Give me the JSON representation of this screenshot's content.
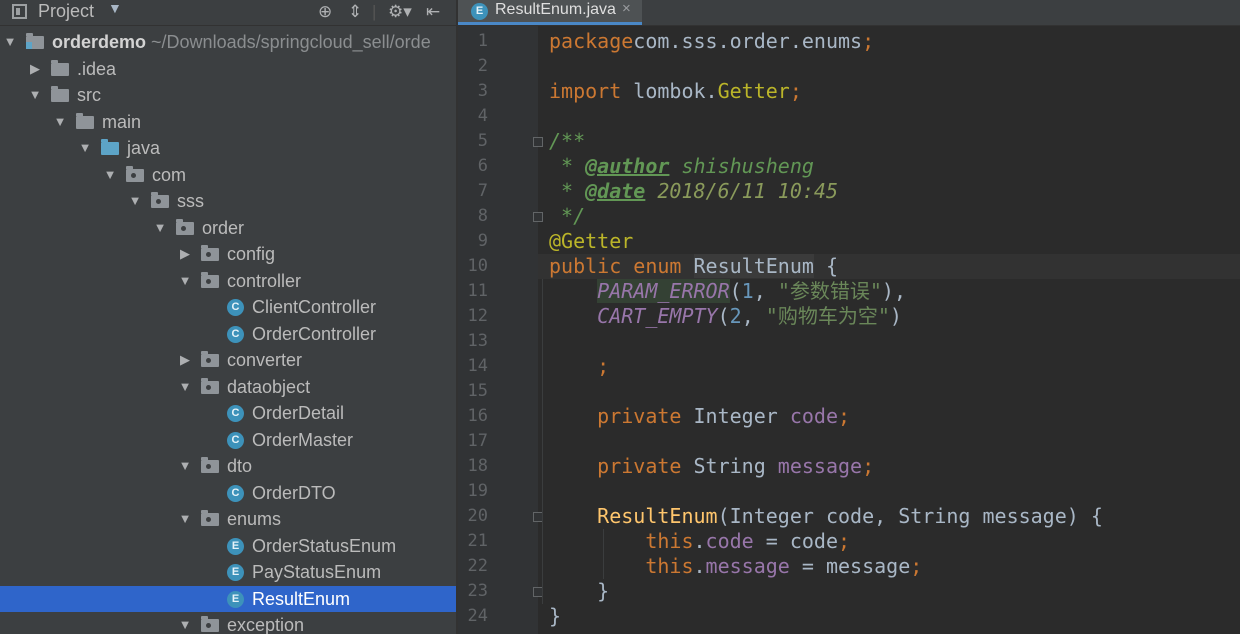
{
  "project_panel": {
    "title": "Project",
    "tree": [
      {
        "label": "orderdemo",
        "hint": "~/Downloads/springcloud_sell/orde",
        "kind": "module",
        "depth": 0,
        "state": "open"
      },
      {
        "label": ".idea",
        "kind": "folder",
        "depth": 1,
        "state": "closed"
      },
      {
        "label": "src",
        "kind": "folder",
        "depth": 1,
        "state": "open"
      },
      {
        "label": "main",
        "kind": "folder",
        "depth": 2,
        "state": "open"
      },
      {
        "label": "java",
        "kind": "source-folder",
        "depth": 3,
        "state": "open"
      },
      {
        "label": "com",
        "kind": "package",
        "depth": 4,
        "state": "open"
      },
      {
        "label": "sss",
        "kind": "package",
        "depth": 5,
        "state": "open"
      },
      {
        "label": "order",
        "kind": "package",
        "depth": 6,
        "state": "open"
      },
      {
        "label": "config",
        "kind": "package",
        "depth": 7,
        "state": "closed"
      },
      {
        "label": "controller",
        "kind": "package",
        "depth": 7,
        "state": "open"
      },
      {
        "label": "ClientController",
        "kind": "class",
        "badge": "C",
        "depth": 8
      },
      {
        "label": "OrderController",
        "kind": "class",
        "badge": "C",
        "depth": 8
      },
      {
        "label": "converter",
        "kind": "package",
        "depth": 7,
        "state": "closed"
      },
      {
        "label": "dataobject",
        "kind": "package",
        "depth": 7,
        "state": "open"
      },
      {
        "label": "OrderDetail",
        "kind": "class",
        "badge": "C",
        "depth": 8
      },
      {
        "label": "OrderMaster",
        "kind": "class",
        "badge": "C",
        "depth": 8
      },
      {
        "label": "dto",
        "kind": "package",
        "depth": 7,
        "state": "open"
      },
      {
        "label": "OrderDTO",
        "kind": "class",
        "badge": "C",
        "depth": 8
      },
      {
        "label": "enums",
        "kind": "package",
        "depth": 7,
        "state": "open"
      },
      {
        "label": "OrderStatusEnum",
        "kind": "enum",
        "badge": "E",
        "depth": 8
      },
      {
        "label": "PayStatusEnum",
        "kind": "enum",
        "badge": "E",
        "depth": 8
      },
      {
        "label": "ResultEnum",
        "kind": "enum",
        "badge": "E",
        "depth": 8,
        "selected": true
      },
      {
        "label": "exception",
        "kind": "package",
        "depth": 7,
        "state": "open"
      }
    ]
  },
  "editor": {
    "tab": {
      "label": "ResultEnum.java",
      "badge": "E",
      "close": "×"
    },
    "current_line": 10,
    "lines": [
      {
        "n": "1",
        "tokens": [
          [
            "kw",
            "package"
          ],
          [
            "",
            "com.sss.order.enums"
          ],
          [
            "kw",
            ";"
          ]
        ]
      },
      {
        "n": "2",
        "tokens": []
      },
      {
        "n": "3",
        "tokens": [
          [
            "kw",
            "import"
          ],
          [
            "",
            " lombok."
          ],
          [
            "ann",
            "Getter"
          ],
          [
            "kw",
            ";"
          ]
        ]
      },
      {
        "n": "4",
        "tokens": []
      },
      {
        "n": "5",
        "tokens": [
          [
            "doc",
            "/**"
          ]
        ]
      },
      {
        "n": "6",
        "tokens": [
          [
            "doc",
            " * "
          ],
          [
            "doctag",
            "@author"
          ],
          [
            "doc",
            " shishusheng"
          ]
        ]
      },
      {
        "n": "7",
        "tokens": [
          [
            "doc",
            " * "
          ],
          [
            "doctag",
            "@date"
          ],
          [
            "docval",
            " 2018/6/11 10:45"
          ]
        ]
      },
      {
        "n": "8",
        "tokens": [
          [
            "doc",
            " */"
          ]
        ]
      },
      {
        "n": "9",
        "tokens": [
          [
            "ann",
            "@Getter"
          ]
        ]
      },
      {
        "n": "10",
        "tokens": [
          [
            "kw",
            "public enum "
          ],
          [
            "hl2",
            "ResultEnum"
          ],
          [
            "",
            " {"
          ]
        ]
      },
      {
        "n": "11",
        "tokens": [
          [
            "",
            ""
          ],
          [
            "cst hl",
            "PARAM_ERROR"
          ],
          [
            "",
            "("
          ],
          [
            "num",
            "1"
          ],
          [
            "",
            ", "
          ],
          [
            "str",
            "\"参数错误\""
          ],
          [
            "",
            "),"
          ]
        ]
      },
      {
        "n": "12",
        "tokens": [
          [
            "",
            ""
          ],
          [
            "cst",
            "CART_EMPTY"
          ],
          [
            "",
            "("
          ],
          [
            "num",
            "2"
          ],
          [
            "",
            ", "
          ],
          [
            "str",
            "\"购物车为空\""
          ],
          [
            "",
            ")"
          ]
        ]
      },
      {
        "n": "13",
        "tokens": []
      },
      {
        "n": "14",
        "tokens": [
          [
            "kw",
            "    ;"
          ]
        ]
      },
      {
        "n": "15",
        "tokens": []
      },
      {
        "n": "16",
        "tokens": [
          [
            "kw",
            "    private "
          ],
          [
            "",
            "Integer "
          ],
          [
            "fld",
            "code"
          ],
          [
            "kw",
            ";"
          ]
        ]
      },
      {
        "n": "17",
        "tokens": []
      },
      {
        "n": "18",
        "tokens": [
          [
            "kw",
            "    private "
          ],
          [
            "",
            "String "
          ],
          [
            "fld",
            "message"
          ],
          [
            "kw",
            ";"
          ]
        ]
      },
      {
        "n": "19",
        "tokens": []
      },
      {
        "n": "20",
        "tokens": [
          [
            "fn",
            "    ResultEnum"
          ],
          [
            "",
            "(Integer code, String message) {"
          ]
        ]
      },
      {
        "n": "21",
        "tokens": [
          [
            "kw",
            "        this"
          ],
          [
            "",
            "."
          ],
          [
            "fld",
            "code"
          ],
          [
            "",
            " = code"
          ],
          [
            "kw",
            ";"
          ]
        ]
      },
      {
        "n": "22",
        "tokens": [
          [
            "kw",
            "        this"
          ],
          [
            "",
            "."
          ],
          [
            "fld",
            "message"
          ],
          [
            "",
            " = message"
          ],
          [
            "kw",
            ";"
          ]
        ]
      },
      {
        "n": "23",
        "tokens": [
          [
            "",
            "    }"
          ]
        ]
      },
      {
        "n": "24",
        "tokens": [
          [
            "",
            "}"
          ]
        ]
      }
    ]
  }
}
